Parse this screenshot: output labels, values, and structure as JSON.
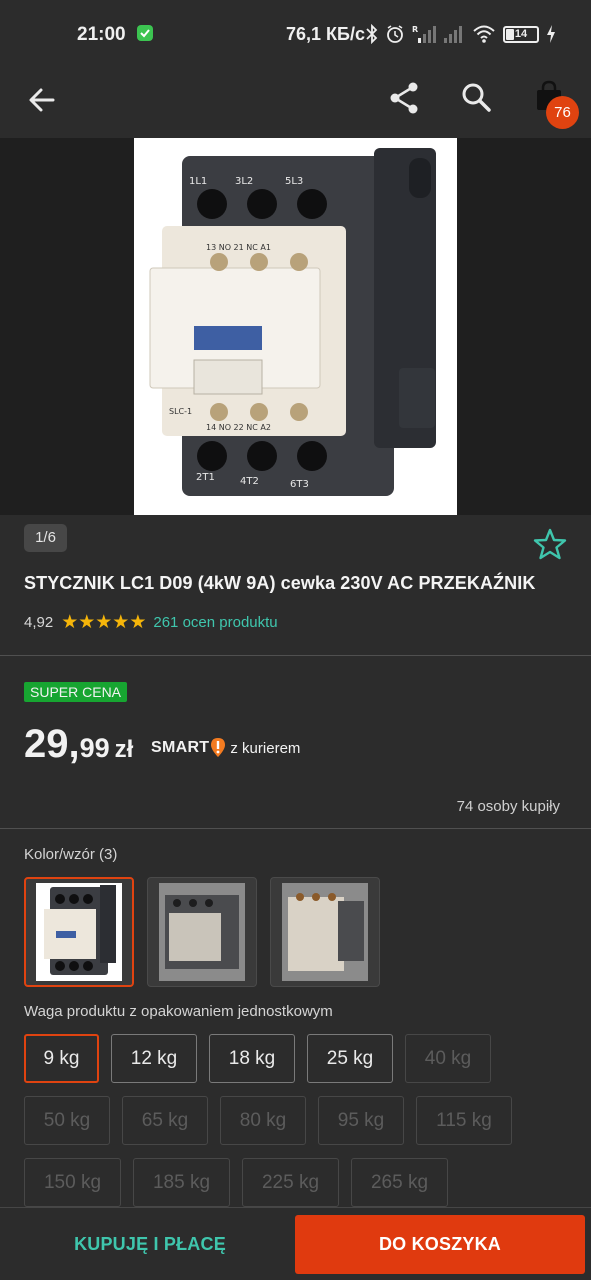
{
  "status": {
    "time": "21:00",
    "speed": "76,1 КБ/с",
    "battery": "14",
    "icons": [
      "shield-check-icon",
      "bluetooth-icon",
      "alarm-icon",
      "signal-r-icon",
      "signal-icon",
      "wifi-icon",
      "battery-icon",
      "charging-icon"
    ]
  },
  "appbar": {
    "icons": [
      "back-arrow-icon",
      "share-icon",
      "search-icon",
      "shopping-bag-icon"
    ],
    "cart_count": "76"
  },
  "gallery": {
    "counter": "1/6"
  },
  "product": {
    "title": "STYCZNIK LC1 D09 (4kW 9A) cewka 230V AC PRZEKAŹNIK",
    "rating_value": "4,92",
    "stars": "★★★★★",
    "rating_fraction": 0.98,
    "ratings_count": "261 ocen produktu"
  },
  "offer": {
    "badge": "SUPER CENA",
    "price_int": "29",
    "price_sep": ",",
    "price_dec": "99",
    "currency": "zł",
    "smart_logo": "SMART",
    "delivery": "z kurierem",
    "buyers": "74 osoby kupiły"
  },
  "variants": {
    "label": "Kolor/wzór (3)",
    "selected_index": 0
  },
  "weights": {
    "label": "Waga produktu z opakowaniem jednostkowym",
    "options": [
      {
        "label": "9 kg",
        "state": "selected"
      },
      {
        "label": "12 kg",
        "state": "available"
      },
      {
        "label": "18 kg",
        "state": "available"
      },
      {
        "label": "25 kg",
        "state": "available"
      },
      {
        "label": "40 kg",
        "state": "unavailable"
      },
      {
        "label": "50 kg",
        "state": "unavailable"
      },
      {
        "label": "65 kg",
        "state": "unavailable"
      },
      {
        "label": "80 kg",
        "state": "unavailable"
      },
      {
        "label": "95 kg",
        "state": "unavailable"
      },
      {
        "label": "115 kg",
        "state": "unavailable"
      },
      {
        "label": "150 kg",
        "state": "unavailable"
      },
      {
        "label": "185 kg",
        "state": "unavailable"
      },
      {
        "label": "225 kg",
        "state": "unavailable"
      },
      {
        "label": "265 kg",
        "state": "unavailable"
      }
    ]
  },
  "actions": {
    "buy_now": "KUPUJĘ I PŁACĘ",
    "add_to_cart": "DO KOSZYKA"
  },
  "colors": {
    "accent": "#e03a0f",
    "teal": "#3fc6ad",
    "badge_green": "#17a531",
    "star": "#f5b50a",
    "background": "#2c2c2c"
  }
}
